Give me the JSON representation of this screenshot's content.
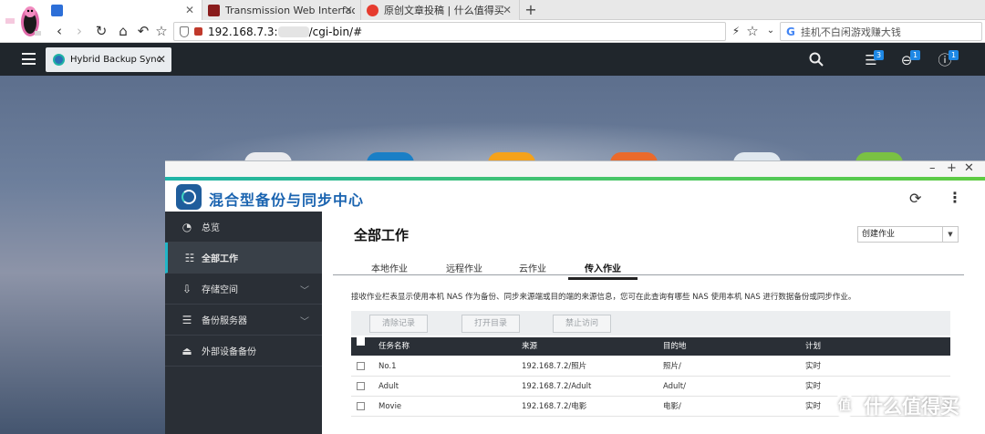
{
  "browser": {
    "tabs": [
      {
        "label": "",
        "active": true
      },
      {
        "label": "Transmission Web Interface",
        "active": false
      },
      {
        "label": "原创文章投稿 | 什么值得买",
        "active": false
      }
    ],
    "url_prefix": "192.168.7.3:",
    "url_suffix": "/cgi-bin/#",
    "search_placeholder": "挂机不白闲游戏赚大钱",
    "colors": {
      "tab_strip": "#e8e8e8",
      "qts_bar": "#20262c"
    }
  },
  "qts": {
    "app_tab_label": "Hybrid Backup Sync",
    "badges": {
      "tasks": "3",
      "notices": "1",
      "events": "1"
    }
  },
  "app": {
    "title": "混合型备份与同步中心",
    "sidebar": [
      {
        "label": "总览",
        "icon": "gauge-icon",
        "active": false,
        "expandable": false
      },
      {
        "label": "全部工作",
        "icon": "list-icon",
        "active": true,
        "expandable": false
      },
      {
        "label": "存储空间",
        "icon": "download-icon",
        "active": false,
        "expandable": true
      },
      {
        "label": "备份服务器",
        "icon": "server-icon",
        "active": false,
        "expandable": true
      },
      {
        "label": "外部设备备份",
        "icon": "external-drive-icon",
        "active": false,
        "expandable": false
      }
    ],
    "page_title": "全部工作",
    "create_dropdown": "创建作业",
    "tabs": [
      "本地作业",
      "远程作业",
      "云作业",
      "传入作业"
    ],
    "active_tab": "传入作业",
    "description": "接收作业栏表显示使用本机 NAS 作为备份、同步来源端或目的端的来源信息，您可在此查询有哪些 NAS 使用本机 NAS 进行数据备份或同步作业。",
    "buttons": {
      "clear_logs": "清除记录",
      "open_dir": "打开目录",
      "block_access": "禁止访问"
    },
    "table": {
      "columns": [
        "任务名称",
        "来源",
        "目的地",
        "计划"
      ],
      "rows": [
        {
          "name": "No.1",
          "source": "192.168.7.2/照片",
          "destination": "照片/",
          "schedule": "实时"
        },
        {
          "name": "Adult",
          "source": "192.168.7.2/Adult",
          "destination": "Adult/",
          "schedule": "实时"
        },
        {
          "name": "Movie",
          "source": "192.168.7.2/电影",
          "destination": "电影/",
          "schedule": "实时"
        }
      ]
    },
    "colors": {
      "accent_teal": "#1fb4a8",
      "accent_green": "#5ecb42",
      "sidebar_bg": "#2a2f36",
      "title_blue": "#1b64b0"
    }
  },
  "watermark": {
    "text": "什么值得买",
    "badge": "值"
  }
}
